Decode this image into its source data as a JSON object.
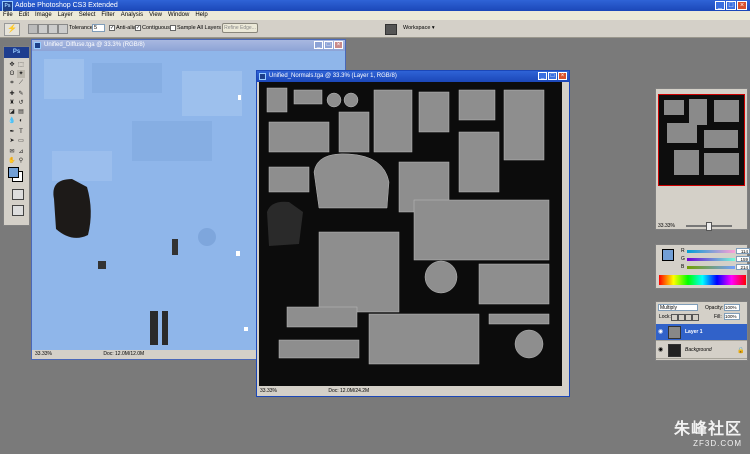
{
  "app": {
    "title": "Adobe Photoshop CS3 Extended",
    "logo": "Ps"
  },
  "menu": [
    "File",
    "Edit",
    "Image",
    "Layer",
    "Select",
    "Filter",
    "Analysis",
    "View",
    "Window",
    "Help"
  ],
  "options_bar": {
    "tolerance_label": "Tolerance:",
    "tolerance_value": "5",
    "anti_alias_label": "Anti-alias",
    "contiguous_label": "Contiguous",
    "sample_all_label": "Sample All Layers",
    "refine_edge_label": "Refine Edge...",
    "workspace_label": "Workspace ▾"
  },
  "toolbox": {
    "header": "Ps"
  },
  "doc_diffuse": {
    "title": "Unified_Diffuse.tga @ 33.3% (RGB/8)",
    "zoom": "33.33%",
    "doc_size": "Doc: 12.0M/12.0M",
    "fill_color": "#8fb6ea"
  },
  "doc_normals": {
    "title": "Unified_Normals.tga @ 33.3% (Layer 1, RGB/8)",
    "zoom": "33.33%",
    "doc_size": "Doc: 12.0M/24.2M"
  },
  "navigator": {
    "zoom": "33.33%"
  },
  "color_panel": {
    "r_label": "R",
    "r_value": "114",
    "g_label": "G",
    "g_value": "159",
    "b_label": "B",
    "b_value": "214"
  },
  "layers_panel": {
    "blend_mode": "Multiply",
    "opacity_label": "Opacity:",
    "opacity_value": "100%",
    "lock_label": "Lock:",
    "fill_label": "Fill:",
    "fill_value": "100%",
    "layers": [
      {
        "name": "Layer 1",
        "selected": true
      },
      {
        "name": "Background",
        "selected": false
      }
    ]
  },
  "watermark": {
    "brand": "朱峰社区",
    "site": "ZF3D.COM"
  },
  "colors": {
    "title_blue": "#1b47b8",
    "selection_blue": "#3162c9",
    "diffuse_blue": "#8fb6ea"
  }
}
